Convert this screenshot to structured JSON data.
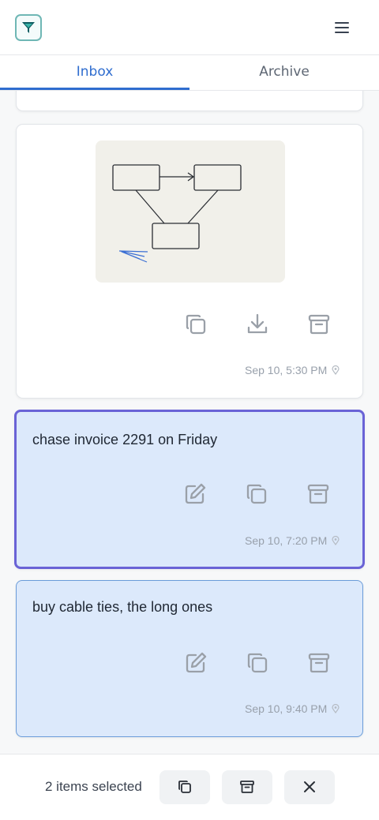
{
  "header": {
    "logo_icon": "funnel-logo-icon",
    "menu_icon": "hamburger-menu-icon"
  },
  "tabs": [
    {
      "label": "Inbox",
      "active": true
    },
    {
      "label": "Archive",
      "active": false
    }
  ],
  "cards": [
    {
      "type": "image",
      "image_description_icon": "sketch-diagram-image",
      "actions": [
        "copy-icon",
        "download-icon",
        "archive-icon"
      ],
      "timestamp": "Sep 10, 5:30 PM"
    },
    {
      "type": "note",
      "text": "chase invoice 2291 on Friday",
      "selected": true,
      "actions": [
        "edit-icon",
        "copy-icon",
        "archive-icon"
      ],
      "timestamp": "Sep 10, 7:20 PM"
    },
    {
      "type": "note",
      "text": "buy cable ties, the long ones",
      "selected": false,
      "actions": [
        "edit-icon",
        "copy-icon",
        "archive-icon"
      ],
      "timestamp": "Sep 10, 9:40 PM"
    }
  ],
  "footer": {
    "selection_label": "2 items selected",
    "actions": [
      "copy-icon",
      "archive-icon",
      "close-icon"
    ]
  },
  "colors": {
    "accent": "#2f6dcf",
    "selected_border": "#6a63d6",
    "note_bg": "#dce9fb",
    "note_border": "#6a9cd9"
  }
}
